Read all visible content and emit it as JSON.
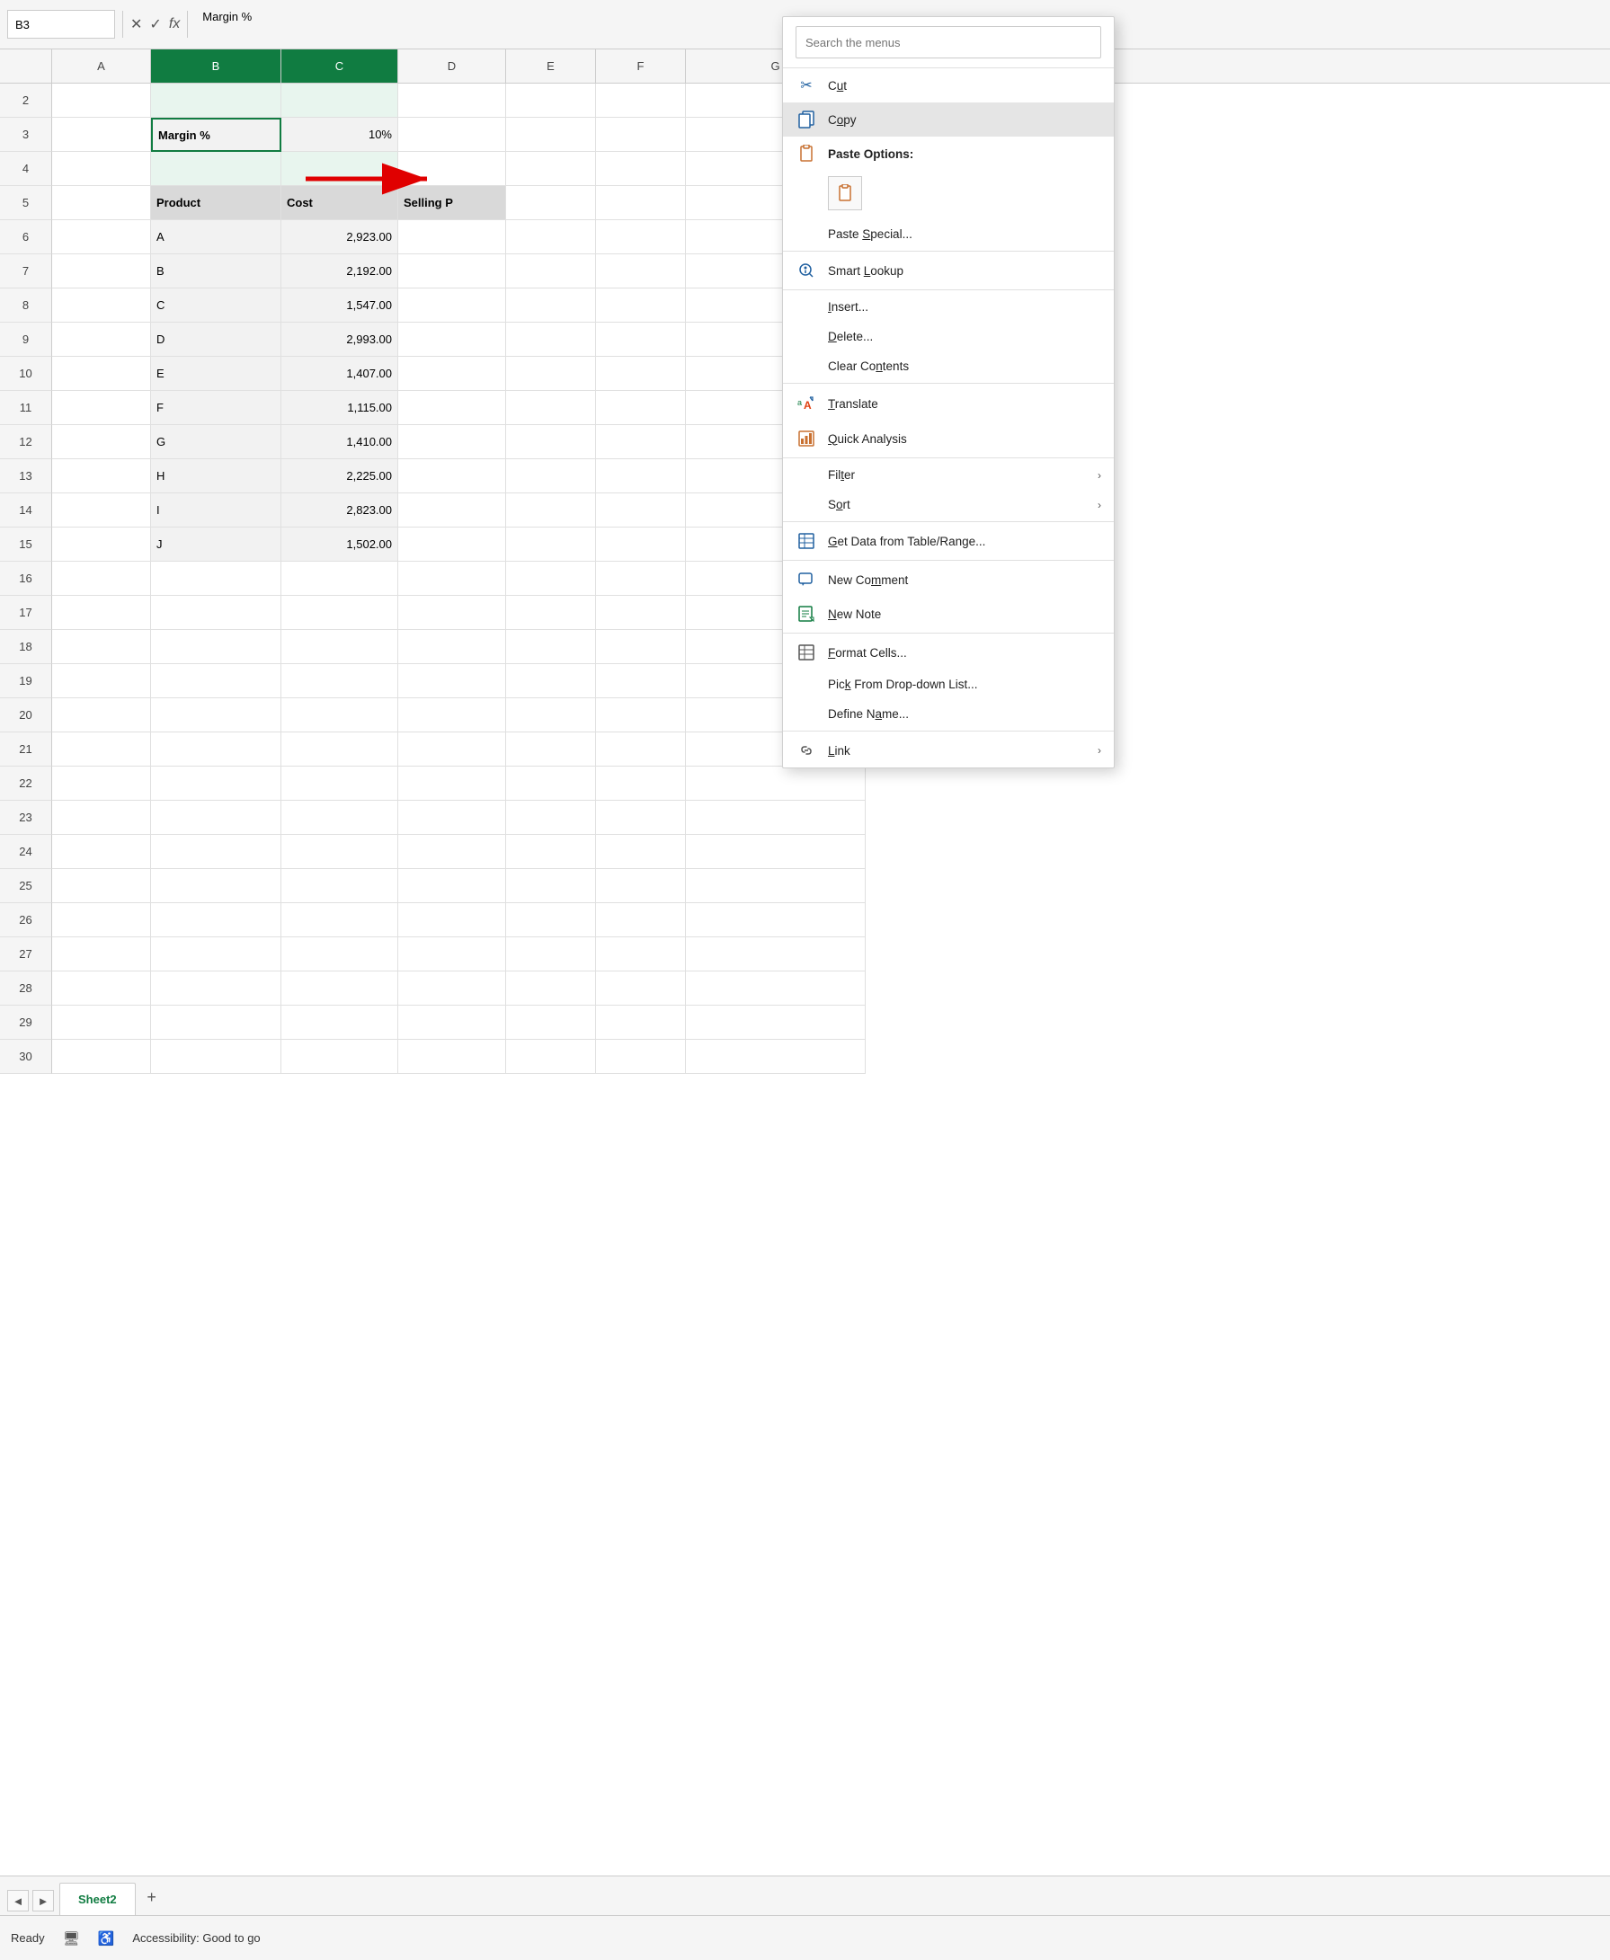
{
  "formulaBar": {
    "cellRef": "B3",
    "content": "Margin %",
    "icons": [
      "×",
      "✓",
      "fx"
    ]
  },
  "columns": [
    {
      "id": "corner",
      "label": ""
    },
    {
      "id": "A",
      "label": "A",
      "class": "col-a"
    },
    {
      "id": "B",
      "label": "B",
      "class": "col-b",
      "selected": true
    },
    {
      "id": "C",
      "label": "C",
      "class": "col-c",
      "selected": true
    },
    {
      "id": "D",
      "label": "D",
      "class": "col-d"
    },
    {
      "id": "E",
      "label": "E",
      "class": "col-e"
    },
    {
      "id": "F",
      "label": "F",
      "class": "col-f"
    },
    {
      "id": "G",
      "label": "G",
      "class": "col-g"
    }
  ],
  "rows": [
    {
      "num": 2,
      "cells": [
        "",
        "",
        "",
        "",
        "",
        "",
        ""
      ]
    },
    {
      "num": 3,
      "cells": [
        "",
        "Margin %",
        "10%",
        "",
        "",
        "",
        ""
      ],
      "special": "margin"
    },
    {
      "num": 4,
      "cells": [
        "",
        "",
        "",
        "",
        "",
        "",
        ""
      ]
    },
    {
      "num": 5,
      "cells": [
        "",
        "Product",
        "Cost",
        "Selling P",
        "",
        "",
        ""
      ],
      "header": true
    },
    {
      "num": 6,
      "cells": [
        "",
        "A",
        "2,923.00",
        "",
        "",
        "",
        ""
      ]
    },
    {
      "num": 7,
      "cells": [
        "",
        "B",
        "2,192.00",
        "",
        "",
        "",
        ""
      ]
    },
    {
      "num": 8,
      "cells": [
        "",
        "C",
        "1,547.00",
        "",
        "",
        "",
        ""
      ]
    },
    {
      "num": 9,
      "cells": [
        "",
        "D",
        "2,993.00",
        "",
        "",
        "",
        ""
      ]
    },
    {
      "num": 10,
      "cells": [
        "",
        "E",
        "1,407.00",
        "",
        "",
        "",
        ""
      ]
    },
    {
      "num": 11,
      "cells": [
        "",
        "F",
        "1,115.00",
        "",
        "",
        "",
        ""
      ]
    },
    {
      "num": 12,
      "cells": [
        "",
        "G",
        "1,410.00",
        "",
        "",
        "",
        ""
      ]
    },
    {
      "num": 13,
      "cells": [
        "",
        "H",
        "2,225.00",
        "",
        "",
        "",
        ""
      ]
    },
    {
      "num": 14,
      "cells": [
        "",
        "I",
        "2,823.00",
        "",
        "",
        "",
        ""
      ]
    },
    {
      "num": 15,
      "cells": [
        "",
        "J",
        "1,502.00",
        "",
        "",
        "",
        ""
      ]
    },
    {
      "num": 16,
      "cells": [
        "",
        "",
        "",
        "",
        "",
        "",
        ""
      ]
    },
    {
      "num": 17,
      "cells": [
        "",
        "",
        "",
        "",
        "",
        "",
        ""
      ]
    },
    {
      "num": 18,
      "cells": [
        "",
        "",
        "",
        "",
        "",
        "",
        ""
      ]
    },
    {
      "num": 19,
      "cells": [
        "",
        "",
        "",
        "",
        "",
        "",
        ""
      ]
    },
    {
      "num": 20,
      "cells": [
        "",
        "",
        "",
        "",
        "",
        "",
        ""
      ]
    },
    {
      "num": 21,
      "cells": [
        "",
        "",
        "",
        "",
        "",
        "",
        ""
      ]
    },
    {
      "num": 22,
      "cells": [
        "",
        "",
        "",
        "",
        "",
        "",
        ""
      ]
    },
    {
      "num": 23,
      "cells": [
        "",
        "",
        "",
        "",
        "",
        "",
        ""
      ]
    },
    {
      "num": 24,
      "cells": [
        "",
        "",
        "",
        "",
        "",
        "",
        ""
      ]
    },
    {
      "num": 25,
      "cells": [
        "",
        "",
        "",
        "",
        "",
        "",
        ""
      ]
    },
    {
      "num": 26,
      "cells": [
        "",
        "",
        "",
        "",
        "",
        "",
        ""
      ]
    },
    {
      "num": 27,
      "cells": [
        "",
        "",
        "",
        "",
        "",
        "",
        ""
      ]
    },
    {
      "num": 28,
      "cells": [
        "",
        "",
        "",
        "",
        "",
        "",
        ""
      ]
    },
    {
      "num": 29,
      "cells": [
        "",
        "",
        "",
        "",
        "",
        "",
        ""
      ]
    },
    {
      "num": 30,
      "cells": [
        "",
        "",
        "",
        "",
        "",
        "",
        ""
      ]
    }
  ],
  "contextMenu": {
    "searchPlaceholder": "Search the menus",
    "items": [
      {
        "id": "cut",
        "label": "Cut",
        "underline": "u",
        "icon": "✂",
        "iconClass": "icon-blue",
        "hasArrow": false
      },
      {
        "id": "copy",
        "label": "Copy",
        "underline": "o",
        "icon": "📋",
        "iconClass": "icon-blue",
        "hasArrow": false,
        "highlighted": true
      },
      {
        "id": "paste-options",
        "label": "Paste Options:",
        "underline": "",
        "icon": "📋",
        "iconClass": "icon-orange",
        "hasArrow": false,
        "isBold": true
      },
      {
        "id": "paste-special",
        "label": "Paste Special...",
        "underline": "S",
        "icon": "",
        "hasArrow": false
      },
      {
        "id": "smart-lookup",
        "label": "Smart Lookup",
        "underline": "L",
        "icon": "🔍",
        "iconClass": "icon-blue",
        "hasArrow": false
      },
      {
        "id": "insert",
        "label": "Insert...",
        "underline": "I",
        "icon": "",
        "hasArrow": false
      },
      {
        "id": "delete",
        "label": "Delete...",
        "underline": "D",
        "icon": "",
        "hasArrow": false
      },
      {
        "id": "clear-contents",
        "label": "Clear Contents",
        "underline": "n",
        "icon": "",
        "hasArrow": false
      },
      {
        "id": "translate",
        "label": "Translate",
        "underline": "T",
        "icon": "🔤",
        "iconClass": "icon-green",
        "hasArrow": false
      },
      {
        "id": "quick-analysis",
        "label": "Quick Analysis",
        "underline": "Q",
        "icon": "📊",
        "iconClass": "icon-orange",
        "hasArrow": false
      },
      {
        "id": "filter",
        "label": "Filter",
        "underline": "i",
        "icon": "",
        "hasArrow": true
      },
      {
        "id": "sort",
        "label": "Sort",
        "underline": "o",
        "icon": "",
        "hasArrow": true
      },
      {
        "id": "get-data",
        "label": "Get Data from Table/Range...",
        "underline": "G",
        "icon": "📋",
        "iconClass": "icon-blue",
        "hasArrow": false
      },
      {
        "id": "new-comment",
        "label": "New Comment",
        "underline": "m",
        "icon": "💬",
        "iconClass": "icon-blue",
        "hasArrow": false
      },
      {
        "id": "new-note",
        "label": "New Note",
        "underline": "N",
        "icon": "📝",
        "iconClass": "icon-green",
        "hasArrow": false
      },
      {
        "id": "format-cells",
        "label": "Format Cells...",
        "underline": "F",
        "icon": "📋",
        "iconClass": "icon-gray",
        "hasArrow": false
      },
      {
        "id": "pick-dropdown",
        "label": "Pick From Drop-down List...",
        "underline": "k",
        "icon": "",
        "hasArrow": false
      },
      {
        "id": "define-name",
        "label": "Define Name...",
        "underline": "a",
        "icon": "",
        "hasArrow": false
      },
      {
        "id": "link",
        "label": "Link",
        "underline": "L",
        "icon": "🔗",
        "hasArrow": true
      }
    ]
  },
  "sheetTabs": {
    "tabs": [
      {
        "label": "Sheet2",
        "active": true
      }
    ],
    "addLabel": "+",
    "navButtons": [
      "◄",
      "►"
    ]
  },
  "statusBar": {
    "ready": "Ready",
    "accessibility": "Accessibility: Good to go"
  }
}
